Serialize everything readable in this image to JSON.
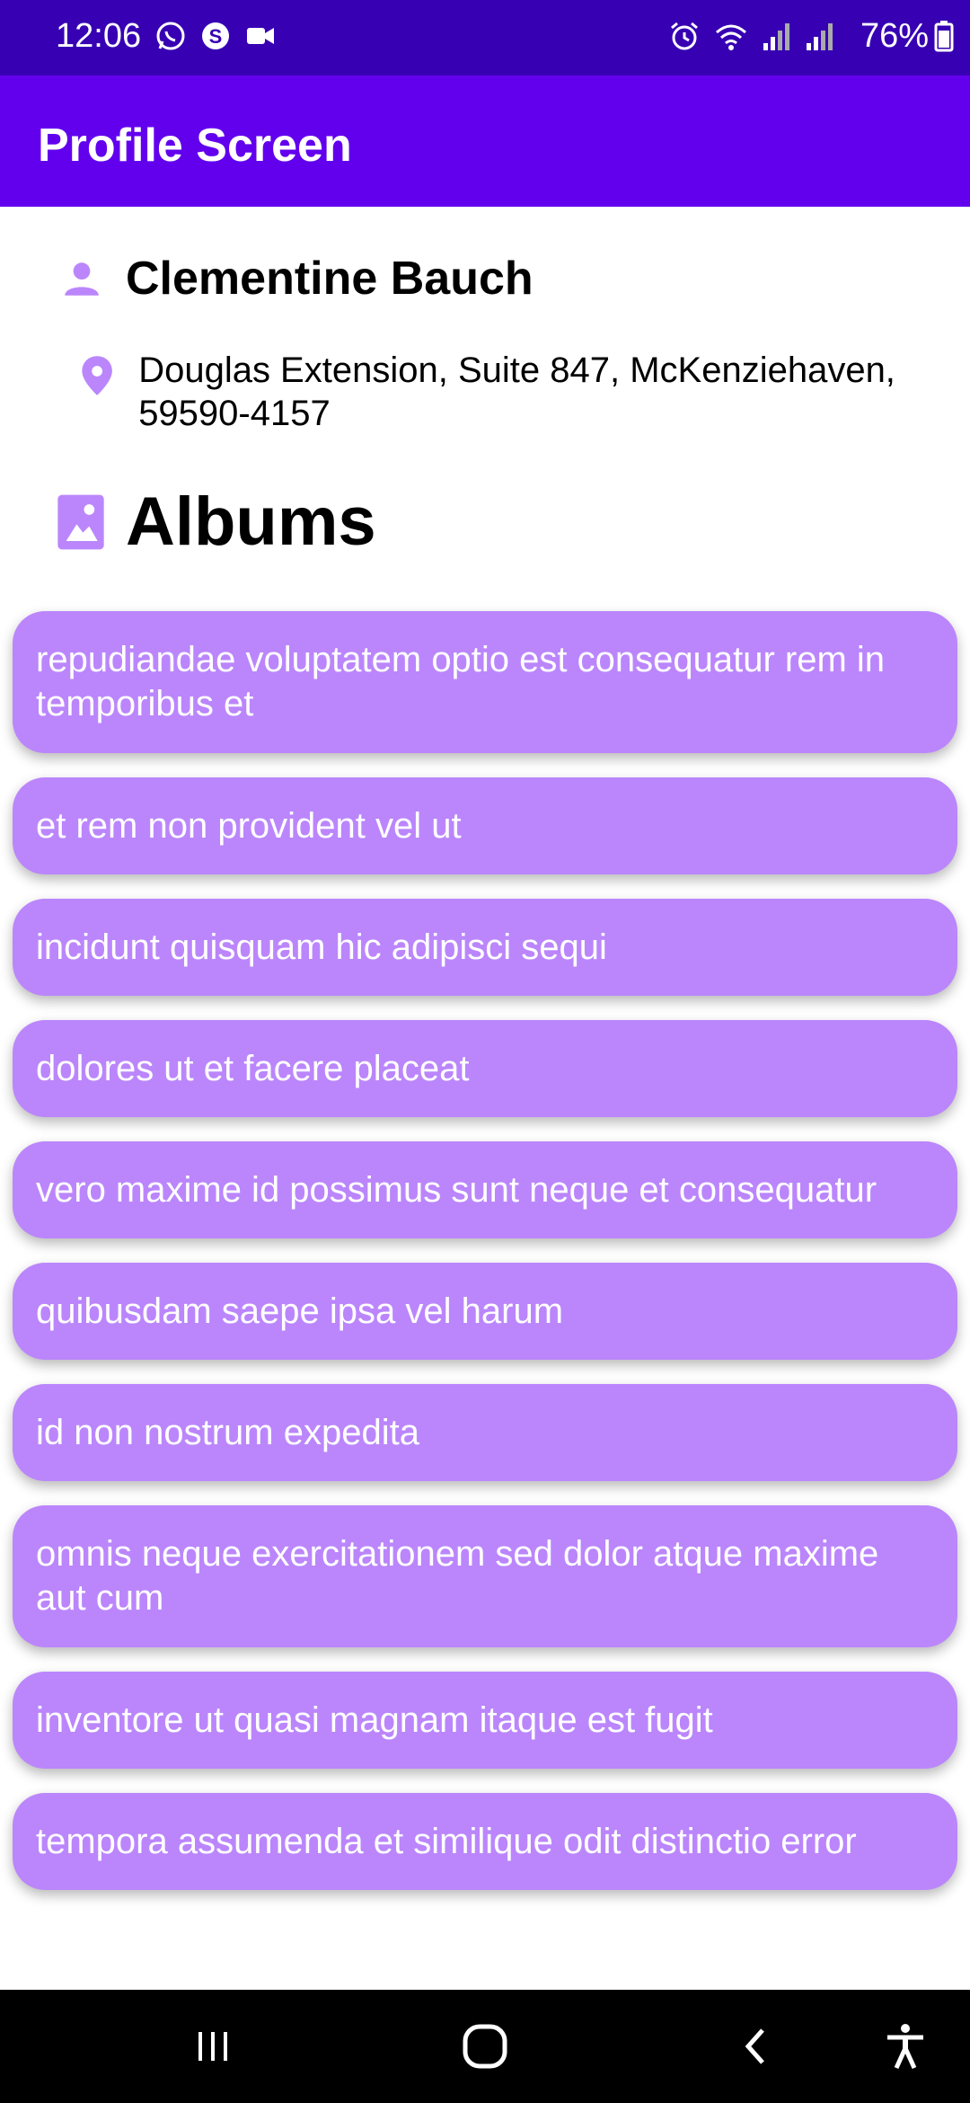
{
  "status_bar": {
    "time": "12:06",
    "battery": "76%",
    "left_icons": [
      "whatsapp-icon",
      "skype-icon",
      "video-icon"
    ],
    "right_icons": [
      "alarm-icon",
      "wifi-icon",
      "signal-icon",
      "signal-icon"
    ],
    "background": "#3700B3"
  },
  "app_bar": {
    "title": "Profile Screen",
    "background": "#6200EE"
  },
  "profile": {
    "name": "Clementine Bauch",
    "address": "Douglas Extension, Suite 847, McKenziehaven, 59590-4157",
    "icon_color": "#BB86FC"
  },
  "albums": {
    "title": "Albums",
    "card_color": "#BB86FC",
    "items": [
      "repudiandae voluptatem optio est consequatur rem in temporibus et",
      "et rem non provident vel ut",
      "incidunt quisquam hic adipisci sequi",
      "dolores ut et facere placeat",
      "vero maxime id possimus sunt neque et consequatur",
      "quibusdam saepe ipsa vel harum",
      "id non nostrum expedita",
      "omnis neque exercitationem sed dolor atque maxime aut cum",
      "inventore ut quasi magnam itaque est fugit",
      "tempora assumenda et similique odit distinctio error"
    ]
  },
  "nav_bar": {
    "buttons": [
      "recent-apps-icon",
      "home-icon",
      "back-icon",
      "accessibility-icon"
    ]
  }
}
